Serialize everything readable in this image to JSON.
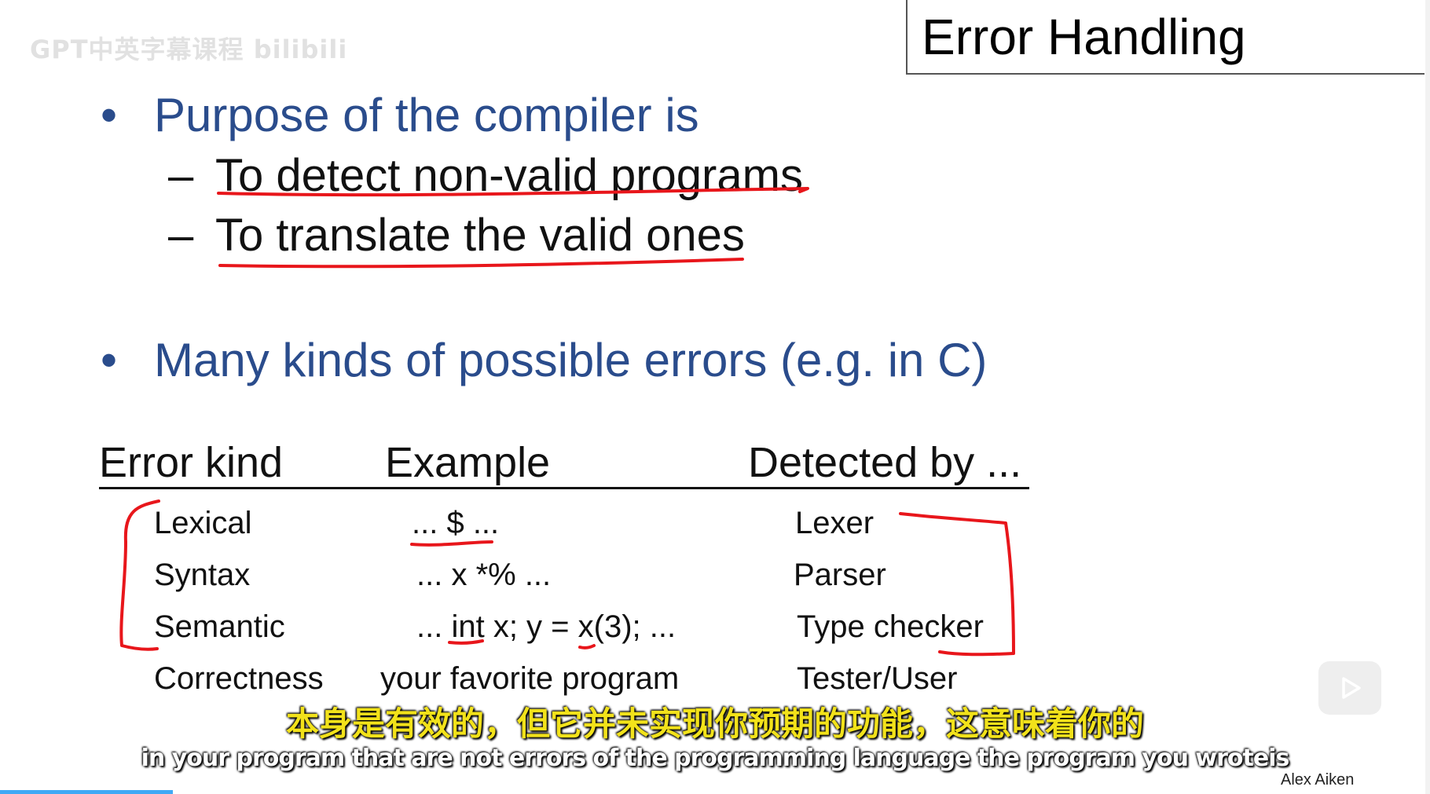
{
  "watermark": "GPT中英字幕课程 bilibili",
  "slide": {
    "title": "Error Handling",
    "bullets": [
      {
        "text": "Purpose of the compiler is",
        "subitems": [
          "To detect non-valid programs",
          "To translate the valid ones"
        ]
      },
      {
        "text": "Many kinds of possible errors (e.g. in C)"
      }
    ],
    "bullet_glyph": "•",
    "dash_glyph": "–",
    "table": {
      "headers": [
        "Error kind",
        "Example",
        "Detected by ..."
      ],
      "rows": [
        [
          "Lexical",
          "... $ ...",
          "Lexer"
        ],
        [
          "Syntax",
          "... x *% ...",
          "Parser"
        ],
        [
          "Semantic",
          "... int x; y = x(3); ...",
          "Type checker"
        ],
        [
          "Correctness",
          "your favorite program",
          "Tester/User"
        ]
      ]
    },
    "author": "Alex Aiken"
  },
  "subtitles": {
    "chinese": "本身是有效的，但它并未实现你预期的功能，这意味着你的",
    "english": "in your program that are not errors of the programming language the program you wroteis"
  },
  "player": {
    "play_icon": "play-icon"
  },
  "colors": {
    "bullet_blue": "#2a4c8c",
    "ink_red": "#e8161b",
    "subtitle_yellow": "#f2e21a",
    "progress_blue": "#3fa9f5"
  }
}
